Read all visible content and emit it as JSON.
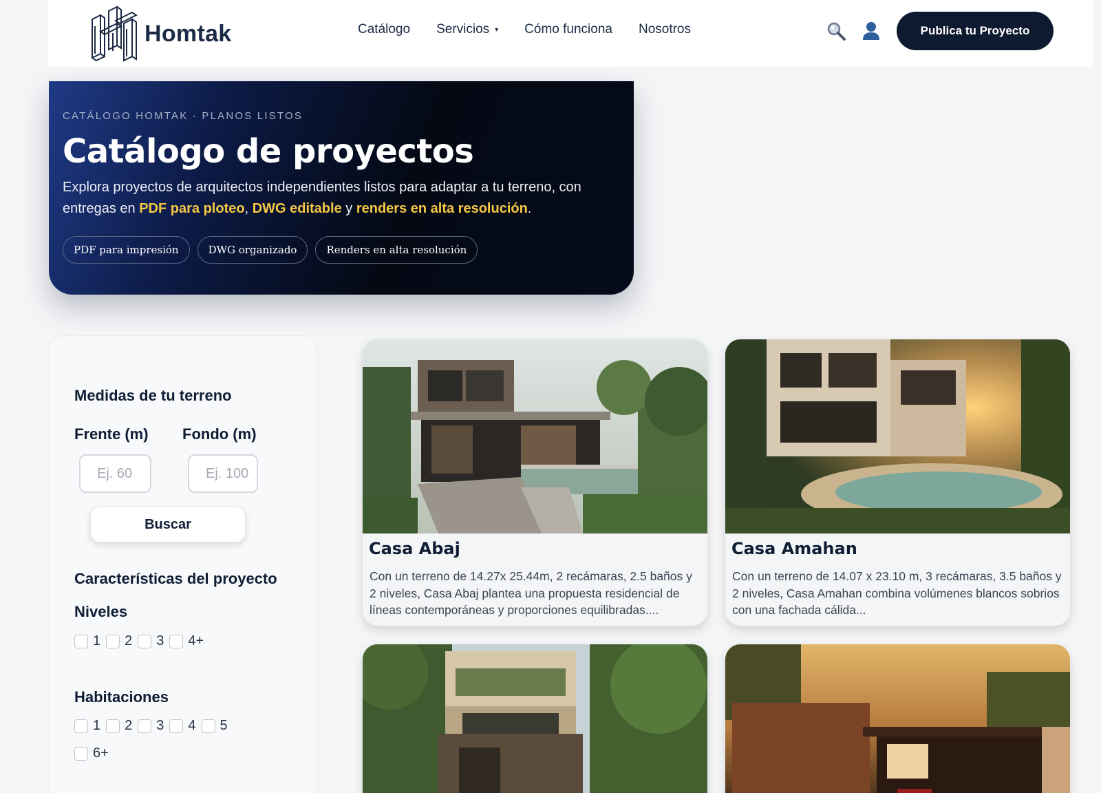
{
  "header": {
    "brand": "Homtak",
    "nav": [
      {
        "label": "Catálogo",
        "caret": false
      },
      {
        "label": "Servicios",
        "caret": true
      },
      {
        "label": "Cómo funciona",
        "caret": false
      },
      {
        "label": "Nosotros",
        "caret": false
      }
    ],
    "caret_glyph": "▾",
    "icons": {
      "search": "search-icon",
      "user": "user-icon"
    },
    "cta": "Publica tu Proyecto"
  },
  "hero": {
    "eyebrow": "CATÁLOGO HOMTAK · PLANOS LISTOS",
    "title": "Catálogo de proyectos",
    "desc_1": "Explora proyectos de arquitectos independientes listos para adaptar a tu terreno, con entregas en ",
    "hl_1": "PDF para ploteo",
    "sep_1": ", ",
    "hl_2": "DWG editable",
    "sep_2": " y ",
    "hl_3": "renders en alta resolución",
    "end": ".",
    "chips": [
      "PDF para impresión",
      "DWG organizado",
      "Renders en alta resolución"
    ]
  },
  "filters": {
    "section_1": "Medidas de tu terreno",
    "frente_label": "Frente (m)",
    "fondo_label": "Fondo (m)",
    "frente_placeholder": "Ej. 60",
    "fondo_placeholder": "Ej. 100",
    "search_button": "Buscar",
    "section_2": "Características del proyecto",
    "niveles_label": "Niveles",
    "niveles": [
      "1",
      "2",
      "3",
      "4+"
    ],
    "habitaciones_label": "Habitaciones",
    "habitaciones_row1": [
      "1",
      "2",
      "3",
      "4",
      "5"
    ],
    "habitaciones_row2": [
      "6+"
    ]
  },
  "cards": [
    {
      "title": "Casa Abaj",
      "desc": "Con un terreno de 14.27x 25.44m, 2 recámaras, 2.5 baños y 2 niveles, Casa Abaj plantea una propuesta residencial de líneas contemporáneas y proporciones equilibradas...."
    },
    {
      "title": "Casa Amahan",
      "desc": "Con un terreno de 14.07 x 23.10 m, 3 recámaras, 3.5 baños y 2 niveles, Casa Amahan combina volúmenes blancos sobrios con una fachada cálida..."
    },
    {
      "title": "",
      "desc": ""
    },
    {
      "title": "",
      "desc": ""
    }
  ],
  "colors": {
    "primary": "#0e1a30",
    "highlight": "#f6c945",
    "hero_start": "#1f3a86",
    "hero_end": "#040914"
  }
}
